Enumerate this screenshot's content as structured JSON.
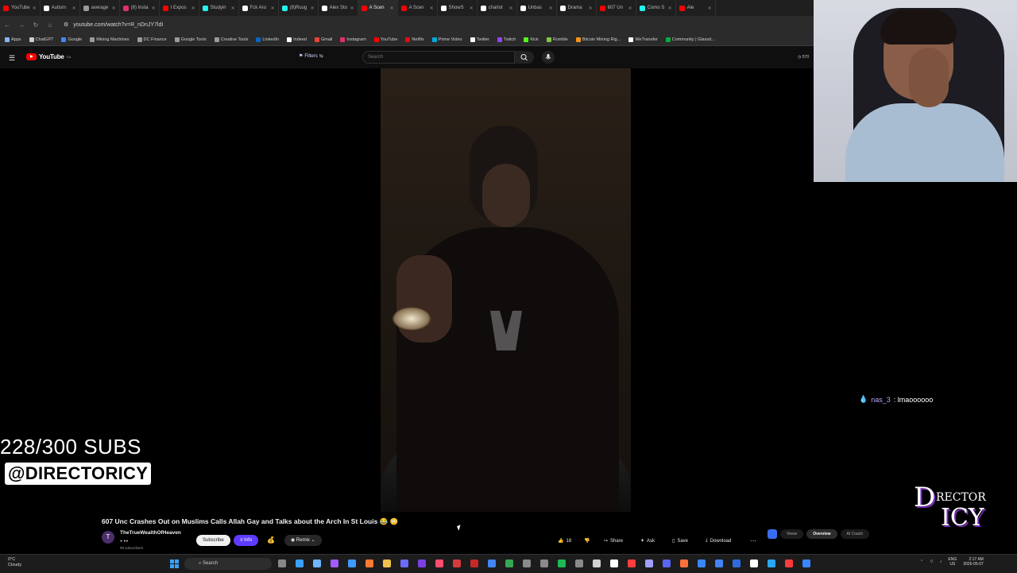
{
  "browser": {
    "tabs": [
      {
        "label": "YouTube",
        "color": "#ff0000",
        "active": false
      },
      {
        "label": "Autism",
        "color": "#ffffff",
        "active": false
      },
      {
        "label": "average",
        "color": "#9a9a9a",
        "active": false
      },
      {
        "label": "(8) Insta",
        "color": "#e1306c",
        "active": false
      },
      {
        "label": "I Expos",
        "color": "#ff0000",
        "active": false
      },
      {
        "label": "Studyin",
        "color": "#25f4ee",
        "active": false
      },
      {
        "label": "Fck Aro",
        "color": "#ffffff",
        "active": false
      },
      {
        "label": "(8)Roug",
        "color": "#25f4ee",
        "active": false
      },
      {
        "label": "Alex Sto",
        "color": "#ffffff",
        "active": false
      },
      {
        "label": "A Scen",
        "color": "#ff0000",
        "active": true
      },
      {
        "label": "A Scen",
        "color": "#ff0000",
        "active": false
      },
      {
        "label": "ShowS",
        "color": "#ffffff",
        "active": false
      },
      {
        "label": "charlot",
        "color": "#ffffff",
        "active": false
      },
      {
        "label": "Unbas",
        "color": "#ffffff",
        "active": false
      },
      {
        "label": "Drama",
        "color": "#ffffff",
        "active": false
      },
      {
        "label": "607 Un",
        "color": "#ff0000",
        "active": false
      },
      {
        "label": "Como S",
        "color": "#25f4ee",
        "active": false
      },
      {
        "label": "Ale",
        "color": "#ff0000",
        "active": false
      }
    ],
    "url": "youtube.com/watch?v=R_nDnJY7ldI",
    "bookmarks": [
      {
        "label": "Apps",
        "color": "#8ab4f8"
      },
      {
        "label": "ChatGPT",
        "color": "#cccccc"
      },
      {
        "label": "Google",
        "color": "#4285f4"
      },
      {
        "label": "Mining Machines",
        "color": "#9a9a9a"
      },
      {
        "label": "DC Finance",
        "color": "#9a9a9a"
      },
      {
        "label": "Google Tools",
        "color": "#9a9a9a"
      },
      {
        "label": "Creative Tools",
        "color": "#9a9a9a"
      },
      {
        "label": "LinkedIn",
        "color": "#0a66c2"
      },
      {
        "label": "Indeed",
        "color": "#ffffff"
      },
      {
        "label": "Gmail",
        "color": "#ea4335"
      },
      {
        "label": "Instagram",
        "color": "#e1306c"
      },
      {
        "label": "YouTube",
        "color": "#ff0000"
      },
      {
        "label": "Netflix",
        "color": "#e50914"
      },
      {
        "label": "Prime Video",
        "color": "#00a8e1"
      },
      {
        "label": "Twitter",
        "color": "#ffffff"
      },
      {
        "label": "Twitch",
        "color": "#9146ff"
      },
      {
        "label": "Kick",
        "color": "#53fc18"
      },
      {
        "label": "Rumble",
        "color": "#85c742"
      },
      {
        "label": "Bitcoin Mining Rig...",
        "color": "#f7931a"
      },
      {
        "label": "WeTransfer",
        "color": "#ffffff"
      },
      {
        "label": "Community | Glassd...",
        "color": "#0caa41"
      }
    ]
  },
  "youtube": {
    "logo_text": "YouTube",
    "region": "CA",
    "filters_label": "Filters",
    "search_placeholder": "Search",
    "counter": "570"
  },
  "video": {
    "title": "607 Unc Crashes Out on Muslims Calls Allah Gay and Talks about the Arch In St Louis 😂 😳",
    "channel_initial": "T",
    "channel_name": "TheTrueWealthOfHeaven",
    "channel_subs": "99 subscribers",
    "subscribe_label": "Subscribe",
    "info_label": "Info",
    "remix_label": "Remix",
    "like_count": "18",
    "share_label": "Share",
    "ask_label": "Ask",
    "save_label": "Save",
    "download_label": "Download"
  },
  "extension": {
    "tabs": [
      "Views",
      "Overview",
      "AI Coach"
    ],
    "active": "Overview"
  },
  "overlay": {
    "subs_goal": "228/300 SUBS",
    "handle": "@DIRECTORICY",
    "chat_user": "nas_3",
    "chat_message": ": lmaoooooo",
    "brand_top": "D",
    "brand_mid": "RECTOR",
    "brand_bottom": "ICY"
  },
  "taskbar": {
    "temp": "0°C",
    "condition": "Cloudy",
    "search_label": "Search",
    "lang_top": "ENG",
    "lang_bottom": "US",
    "time": "2:17 AM",
    "date": "2026-05-07",
    "icon_colors": [
      "#888888",
      "#3aa0ff",
      "#6fb6ff",
      "#a05cff",
      "#3e9bff",
      "#ff7a2f",
      "#f2c14e",
      "#6b6bff",
      "#7b3fe4",
      "#ff4d6d",
      "#d63b3b",
      "#c62828",
      "#4285f4",
      "#34a853",
      "#8a8a8a",
      "#8a8a8a",
      "#1db954",
      "#8a8a8a",
      "#d0d0d0",
      "#ffffff",
      "#ff3d3d",
      "#a0a0ff",
      "#5865f2",
      "#ff7139",
      "#3a86ff",
      "#4285f4",
      "#2d6cdf",
      "#ffffff",
      "#2aa8f2",
      "#ff3b3b",
      "#3a86ff"
    ]
  }
}
